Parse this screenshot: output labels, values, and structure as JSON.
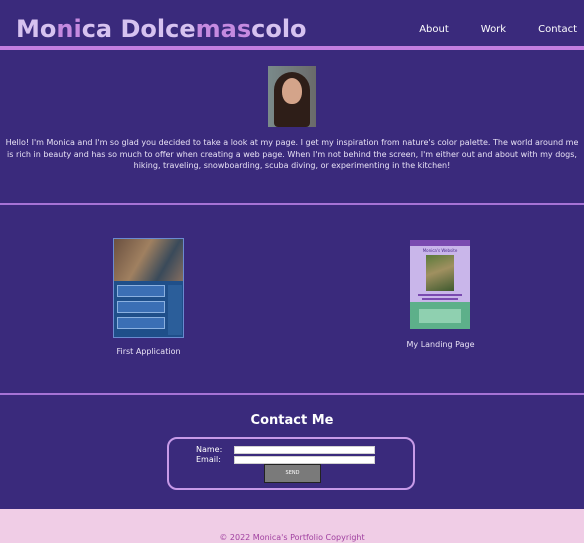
{
  "header": {
    "title_parts": [
      "Mo",
      "ni",
      "ca Dolce",
      "mas",
      "colo"
    ],
    "nav": [
      "About",
      "Work",
      "Contact"
    ]
  },
  "about": {
    "bio": "Hello! I'm Monica and I'm so glad you decided to take a look at my page. I get my inspiration from nature's color palette. The world around me is rich in beauty and has so much to offer when creating a web page. When I'm not behind the screen, I'm either out and about with my dogs, hiking, traveling, snowboarding, scuba diving, or experimenting in the kitchen!"
  },
  "work": {
    "items": [
      {
        "label": "First Application"
      },
      {
        "label": "My Landing Page",
        "thumb_title": "Monica's Website"
      }
    ]
  },
  "contact": {
    "heading": "Contact Me",
    "name_label": "Name:",
    "email_label": "Email:",
    "send_label": "SEND"
  },
  "footer": {
    "copyright": "© 2022 Monica's Portfolio Copyright"
  },
  "colors": {
    "background": "#3a2a7c",
    "accent": "#c27de0",
    "footer": "#f0cde6",
    "footer_text": "#a040a0"
  }
}
